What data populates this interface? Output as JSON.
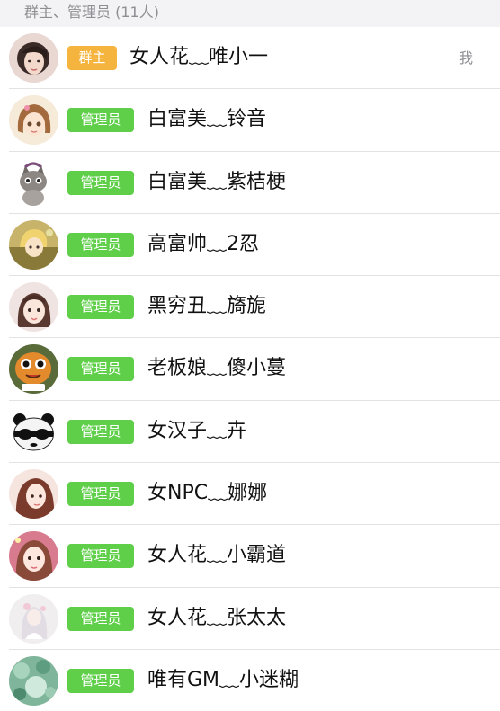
{
  "section": {
    "title": "群主、管理员 (11人)"
  },
  "members": [
    {
      "role": "群主",
      "name": "女人花﹏唯小一",
      "tag": "我",
      "badge_color": "#f5b43e",
      "avatar_icon": "user-avatar-photo"
    },
    {
      "role": "管理员",
      "name": "白富美﹏铃音",
      "badge_color": "#5fcf4a",
      "avatar_icon": "user-avatar-anime-girl"
    },
    {
      "role": "管理员",
      "name": "白富美﹏紫桔梗",
      "badge_color": "#5fcf4a",
      "avatar_icon": "user-avatar-cat"
    },
    {
      "role": "管理员",
      "name": "高富帅﹏2忍",
      "badge_color": "#5fcf4a",
      "avatar_icon": "user-avatar-anime"
    },
    {
      "role": "管理员",
      "name": "黑穷丑﹏旖旎",
      "badge_color": "#5fcf4a",
      "avatar_icon": "user-avatar-photo"
    },
    {
      "role": "管理员",
      "name": "老板娘﹏傻小蔓",
      "badge_color": "#5fcf4a",
      "avatar_icon": "user-avatar-cartoon"
    },
    {
      "role": "管理员",
      "name": "女汉子﹏卉",
      "badge_color": "#5fcf4a",
      "avatar_icon": "user-avatar-panda"
    },
    {
      "role": "管理员",
      "name": "女NPC﹏娜娜",
      "badge_color": "#5fcf4a",
      "avatar_icon": "user-avatar-anime-girl"
    },
    {
      "role": "管理员",
      "name": "女人花﹏小霸道",
      "badge_color": "#5fcf4a",
      "avatar_icon": "user-avatar-photo"
    },
    {
      "role": "管理员",
      "name": "女人花﹏张太太",
      "badge_color": "#5fcf4a",
      "avatar_icon": "user-avatar-illustration"
    },
    {
      "role": "管理员",
      "name": "唯有GM﹏小迷糊",
      "badge_color": "#5fcf4a",
      "avatar_icon": "user-avatar-nature"
    }
  ]
}
